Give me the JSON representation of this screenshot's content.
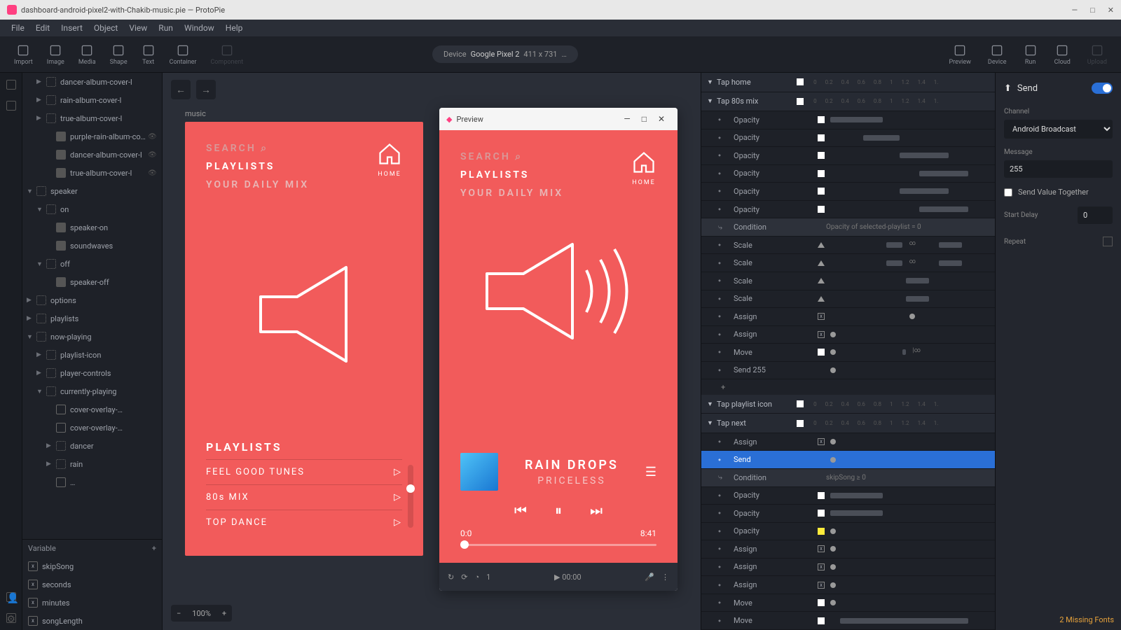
{
  "title": "dashboard-android-pixel2-with-Chakib-music.pie — ProtoPie",
  "menubar": [
    "File",
    "Edit",
    "Insert",
    "Object",
    "View",
    "Run",
    "Window",
    "Help"
  ],
  "toolbar_left": [
    {
      "label": "Import",
      "icon": "import"
    },
    {
      "label": "Image",
      "icon": "image"
    },
    {
      "label": "Media",
      "icon": "media"
    },
    {
      "label": "Shape",
      "icon": "shape"
    },
    {
      "label": "Text",
      "icon": "text"
    },
    {
      "label": "Container",
      "icon": "container"
    },
    {
      "label": "Component",
      "icon": "component"
    }
  ],
  "device_pill": {
    "prefix": "Device",
    "name": "Google Pixel 2",
    "size": "411 x 731",
    "more": "…"
  },
  "toolbar_right": [
    {
      "label": "Preview",
      "icon": "preview"
    },
    {
      "label": "Device",
      "icon": "device"
    },
    {
      "label": "Run",
      "icon": "run"
    },
    {
      "label": "Cloud",
      "icon": "cloud"
    },
    {
      "label": "Upload",
      "icon": "upload"
    }
  ],
  "layers": [
    {
      "name": "dancer-album-cover-l",
      "indent": 1,
      "icon": "dotted",
      "caret": "▶"
    },
    {
      "name": "rain-album-cover-l",
      "indent": 1,
      "icon": "dotted",
      "caret": "▶"
    },
    {
      "name": "true-album-cover-l",
      "indent": 1,
      "icon": "dotted",
      "caret": "▶"
    },
    {
      "name": "purple-rain-album-cove…",
      "indent": 2,
      "icon": "filled",
      "eye": true
    },
    {
      "name": "dancer-album-cover-l",
      "indent": 2,
      "icon": "filled",
      "eye": true
    },
    {
      "name": "true-album-cover-l",
      "indent": 2,
      "icon": "filled",
      "eye": true
    },
    {
      "name": "speaker",
      "indent": 0,
      "icon": "dotted",
      "caret": "▼"
    },
    {
      "name": "on",
      "indent": 1,
      "icon": "dotted",
      "caret": "▼"
    },
    {
      "name": "speaker-on",
      "indent": 2,
      "icon": "filled"
    },
    {
      "name": "soundwaves",
      "indent": 2,
      "icon": "filled"
    },
    {
      "name": "off",
      "indent": 1,
      "icon": "dotted",
      "caret": "▼"
    },
    {
      "name": "speaker-off",
      "indent": 2,
      "icon": "filled"
    },
    {
      "name": "options",
      "indent": 0,
      "icon": "dotted",
      "caret": "▶"
    },
    {
      "name": "playlists",
      "indent": 0,
      "icon": "dotted",
      "caret": "▶"
    },
    {
      "name": "now-playing",
      "indent": 0,
      "icon": "dotted",
      "caret": "▼"
    },
    {
      "name": "playlist-icon",
      "indent": 1,
      "icon": "dotted",
      "caret": "▶"
    },
    {
      "name": "player-controls",
      "indent": 1,
      "icon": "dotted",
      "caret": "▶"
    },
    {
      "name": "currently-playing",
      "indent": 1,
      "icon": "dotted",
      "caret": "▼"
    },
    {
      "name": "cover-overlay-…",
      "indent": 2,
      "icon": "box"
    },
    {
      "name": "cover-overlay-…",
      "indent": 2,
      "icon": "box"
    },
    {
      "name": "dancer",
      "indent": 2,
      "icon": "dotted",
      "caret": "▶"
    },
    {
      "name": "rain",
      "indent": 2,
      "icon": "dotted",
      "caret": "▶"
    },
    {
      "name": "…",
      "indent": 2,
      "icon": "none"
    }
  ],
  "variables_header": "Variable",
  "variables": [
    "skipSong",
    "seconds",
    "minutes",
    "songLength"
  ],
  "canvas": {
    "scene_label": "music",
    "zoom": "100%",
    "artboard": {
      "search": "SEARCH",
      "playlists_label": "PLAYLISTS",
      "daily": "YOUR DAILY MIX",
      "home": "HOME",
      "playlists_title": "PLAYLISTS",
      "items": [
        "FEEL GOOD TUNES",
        "80s MIX",
        "TOP DANCE"
      ]
    }
  },
  "preview": {
    "title": "Preview",
    "search": "SEARCH",
    "playlists_label": "PLAYLISTS",
    "daily": "YOUR DAILY MIX",
    "home": "HOME",
    "song_title": "RAIN DROPS",
    "song_artist": "PRICELESS",
    "time_cur": "0:0",
    "time_total": "8:41",
    "footer_value": "1",
    "footer_time": "00:00"
  },
  "interactions": {
    "triggers": [
      {
        "name": "Tap home",
        "ticks": [
          "0",
          "0.2",
          "0.4",
          "0.6",
          "0.8",
          "1",
          "1.2",
          "1.4",
          "1."
        ],
        "responses": []
      },
      {
        "name": "Tap 80s mix",
        "ticks": [
          "0",
          "0.2",
          "0.4",
          "0.6",
          "0.8",
          "1",
          "1.2",
          "1.4",
          "1."
        ],
        "responses": [
          {
            "type": "Opacity",
            "sq": "#fff",
            "bar": [
              0,
              32
            ]
          },
          {
            "type": "Opacity",
            "sq": "#fff",
            "bar": [
              20,
              22
            ]
          },
          {
            "type": "Opacity",
            "sq": "#fff",
            "bar": [
              42,
              30
            ]
          },
          {
            "type": "Opacity",
            "sq": "#fff",
            "bar": [
              54,
              30
            ]
          },
          {
            "type": "Opacity",
            "sq": "#fff",
            "bar": [
              42,
              30
            ]
          },
          {
            "type": "Opacity",
            "sq": "#fff",
            "bar": [
              54,
              30
            ]
          },
          {
            "type": "Condition",
            "label": "Opacity of selected-playlist = 0",
            "cond": true
          },
          {
            "type": "Scale",
            "sq": "tri",
            "bar": [
              34,
              10
            ],
            "extra": "∞",
            "bar2": [
              66,
              14
            ]
          },
          {
            "type": "Scale",
            "sq": "tri",
            "bar": [
              34,
              10
            ],
            "extra": "∞",
            "bar2": [
              66,
              14
            ]
          },
          {
            "type": "Scale",
            "sq": "tri",
            "bar": [
              46,
              14
            ]
          },
          {
            "type": "Scale",
            "sq": "tri",
            "bar": [
              46,
              14
            ]
          },
          {
            "type": "Assign",
            "sq": "x",
            "dot": [
              48
            ]
          },
          {
            "type": "Assign",
            "sq": "x",
            "dot": [
              0
            ]
          },
          {
            "type": "Move",
            "sq": "#fff",
            "dot": [
              0
            ],
            "extra": "|∞",
            "bar2": [
              44,
              2
            ]
          },
          {
            "type": "Send 255",
            "dot": [
              0
            ]
          },
          {
            "type": "+",
            "add": true
          }
        ]
      },
      {
        "name": "Tap playlist icon",
        "ticks": [
          "0",
          "0.2",
          "0.4",
          "0.6",
          "0.8",
          "1",
          "1.2",
          "1.4",
          "1."
        ],
        "responses": []
      },
      {
        "name": "Tap next",
        "ticks": [
          "0",
          "0.2",
          "0.4",
          "0.6",
          "0.8",
          "1",
          "1.2",
          "1.4",
          "1."
        ],
        "responses": [
          {
            "type": "Assign",
            "sq": "x",
            "dot": [
              0
            ]
          },
          {
            "type": "Send",
            "selected": true,
            "dot": [
              0
            ]
          },
          {
            "type": "Condition",
            "label": "skipSong ≥ 0",
            "cond": true
          },
          {
            "type": "Opacity",
            "sq": "#fff",
            "bar": [
              0,
              32
            ]
          },
          {
            "type": "Opacity",
            "sq": "#fff",
            "bar": [
              0,
              32
            ]
          },
          {
            "type": "Opacity",
            "sq": "#ffeb3b",
            "dot": [
              0
            ]
          },
          {
            "type": "Assign",
            "sq": "x",
            "dot": [
              0
            ]
          },
          {
            "type": "Assign",
            "sq": "x",
            "dot": [
              0
            ]
          },
          {
            "type": "Assign",
            "sq": "x",
            "dot": [
              0
            ]
          },
          {
            "type": "Move",
            "sq": "#fff",
            "dot": [
              0
            ]
          },
          {
            "type": "Move",
            "sq": "#fff",
            "bar": [
              6,
              78
            ]
          }
        ]
      }
    ]
  },
  "props": {
    "title": "Send",
    "channel_label": "Channel",
    "channel_value": "Android Broadcast",
    "message_label": "Message",
    "message_value": "255",
    "send_together": "Send Value Together",
    "start_delay_label": "Start Delay",
    "start_delay_value": "0",
    "repeat_label": "Repeat"
  },
  "font_warning": "2 Missing Fonts"
}
